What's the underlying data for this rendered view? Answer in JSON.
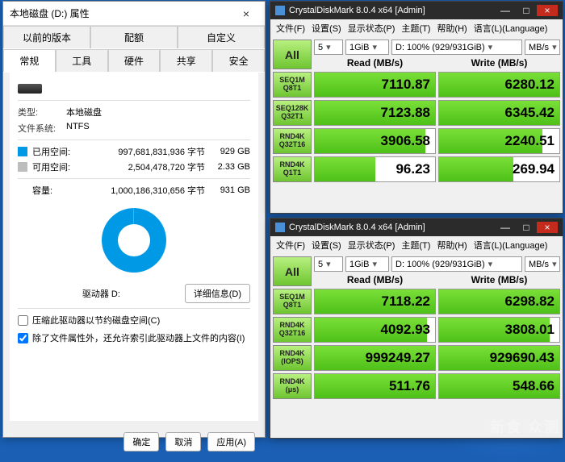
{
  "props": {
    "title": "本地磁盘 (D:) 属性",
    "close": "×",
    "tabs_row1": [
      "以前的版本",
      "配额",
      "自定义"
    ],
    "tabs_row2": [
      "常规",
      "工具",
      "硬件",
      "共享",
      "安全"
    ],
    "type_label": "类型:",
    "type_value": "本地磁盘",
    "fs_label": "文件系统:",
    "fs_value": "NTFS",
    "used_label": "已用空间:",
    "used_bytes": "997,681,831,936 字节",
    "used_gb": "929 GB",
    "free_label": "可用空间:",
    "free_bytes": "2,504,478,720 字节",
    "free_gb": "2.33 GB",
    "cap_label": "容量:",
    "cap_bytes": "1,000,186,310,656 字节",
    "cap_gb": "931 GB",
    "drive_label": "驱动器 D:",
    "details_btn": "详细信息(D)",
    "compress": "压缩此驱动器以节约磁盘空间(C)",
    "index": "除了文件属性外，还允许索引此驱动器上文件的内容(I)",
    "ok": "确定",
    "cancel": "取消",
    "apply": "应用(A)",
    "used_color": "#0099e5",
    "free_color": "#bdbdbd"
  },
  "cdm1": {
    "title": "CrystalDiskMark 8.0.4 x64 [Admin]",
    "menu": [
      "文件(F)",
      "设置(S)",
      "显示状态(P)",
      "主题(T)",
      "帮助(H)",
      "语言(L)(Language)"
    ],
    "all": "All",
    "loops": "5",
    "size": "1GiB",
    "drive": "D: 100% (929/931GiB)",
    "unit": "MB/s",
    "read": "Read (MB/s)",
    "write": "Write (MB/s)",
    "rows": [
      {
        "l1": "SEQ1M",
        "l2": "Q8T1",
        "r": "7110.87",
        "w": "6280.12",
        "rb": 100,
        "wb": 100
      },
      {
        "l1": "SEQ128K",
        "l2": "Q32T1",
        "r": "7123.88",
        "w": "6345.42",
        "rb": 100,
        "wb": 100
      },
      {
        "l1": "RND4K",
        "l2": "Q32T16",
        "r": "3906.58",
        "w": "2240.51",
        "rb": 92,
        "wb": 86
      },
      {
        "l1": "RND4K",
        "l2": "Q1T1",
        "r": "96.23",
        "w": "269.94",
        "rb": 50,
        "wb": 62
      }
    ]
  },
  "cdm2": {
    "title": "CrystalDiskMark 8.0.4 x64 [Admin]",
    "menu": [
      "文件(F)",
      "设置(S)",
      "显示状态(P)",
      "主题(T)",
      "帮助(H)",
      "语言(L)(Language)"
    ],
    "all": "All",
    "loops": "5",
    "size": "1GiB",
    "drive": "D: 100% (929/931GiB)",
    "unit": "MB/s",
    "read": "Read (MB/s)",
    "write": "Write (MB/s)",
    "rows": [
      {
        "l1": "SEQ1M",
        "l2": "Q8T1",
        "r": "7118.22",
        "w": "6298.82",
        "rb": 100,
        "wb": 100
      },
      {
        "l1": "RND4K",
        "l2": "Q32T16",
        "r": "4092.93",
        "w": "3808.01",
        "rb": 93,
        "wb": 92
      },
      {
        "l1": "RND4K",
        "l2": "(IOPS)",
        "r": "999249.27",
        "w": "929690.43",
        "rb": 100,
        "wb": 100
      },
      {
        "l1": "RND4K",
        "l2": "(μs)",
        "r": "511.76",
        "w": "548.66",
        "rb": 100,
        "wb": 100
      }
    ]
  },
  "watermark": "新食 众测"
}
